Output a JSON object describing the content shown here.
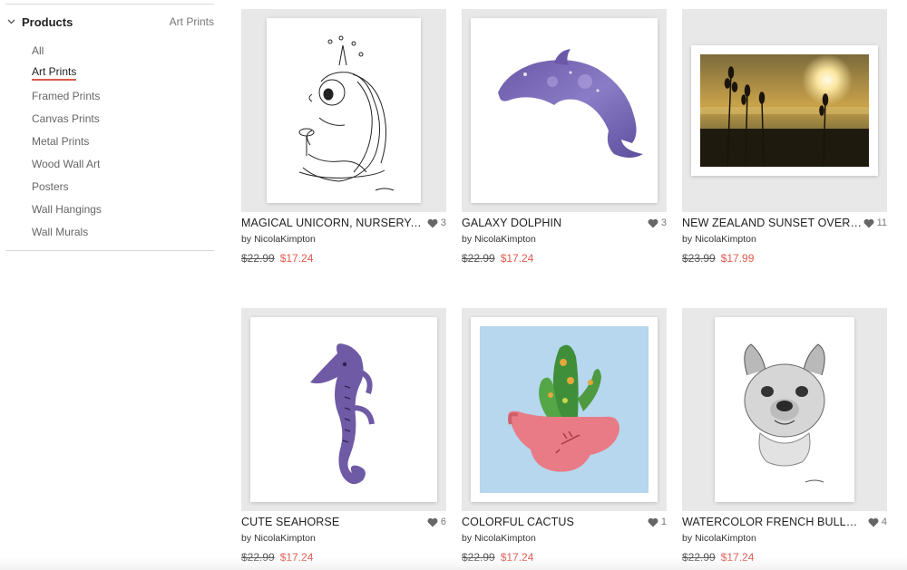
{
  "filter": {
    "title": "Products",
    "current": "Art Prints",
    "items": [
      {
        "label": "All"
      },
      {
        "label": "Art Prints",
        "active": true
      },
      {
        "label": "Framed Prints"
      },
      {
        "label": "Canvas Prints"
      },
      {
        "label": "Metal Prints"
      },
      {
        "label": "Wood Wall Art"
      },
      {
        "label": "Posters"
      },
      {
        "label": "Wall Hangings"
      },
      {
        "label": "Wall Murals"
      }
    ]
  },
  "products": [
    {
      "title": "MAGICAL UNICORN, NURSERY, FAN...",
      "likes": "3",
      "by": "by",
      "artist": "NicolaKimpton",
      "original_price": "$22.99",
      "sale_price": "$17.24",
      "art": "unicorn"
    },
    {
      "title": "GALAXY DOLPHIN",
      "likes": "3",
      "by": "by",
      "artist": "NicolaKimpton",
      "original_price": "$22.99",
      "sale_price": "$17.24",
      "art": "dolphin"
    },
    {
      "title": "NEW ZEALAND SUNSET OVER THE...",
      "likes": "11",
      "by": "by",
      "artist": "NicolaKimpton",
      "original_price": "$23.99",
      "sale_price": "$17.99",
      "art": "sunset"
    },
    {
      "title": "CUTE SEAHORSE",
      "likes": "6",
      "by": "by",
      "artist": "NicolaKimpton",
      "original_price": "$22.99",
      "sale_price": "$17.24",
      "art": "seahorse"
    },
    {
      "title": "COLORFUL CACTUS",
      "likes": "1",
      "by": "by",
      "artist": "NicolaKimpton",
      "original_price": "$22.99",
      "sale_price": "$17.24",
      "art": "cactus"
    },
    {
      "title": "WATERCOLOR FRENCH BULLDOG ...",
      "likes": "4",
      "by": "by",
      "artist": "NicolaKimpton",
      "original_price": "$22.99",
      "sale_price": "$17.24",
      "art": "bulldog"
    }
  ],
  "colors": {
    "accent": "#e05a4f",
    "thumb_bg": "#e8e8e8"
  }
}
